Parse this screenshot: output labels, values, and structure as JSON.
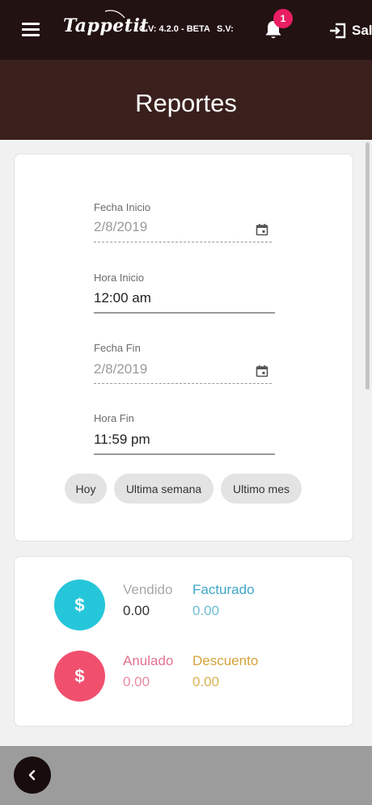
{
  "topbar": {
    "logo_text": "Tappetit",
    "version": "C.V: 4.2.0 - BETA",
    "sv_label": "S.V:",
    "notification_count": "1",
    "exit_label": "Salir"
  },
  "header": {
    "title": "Reportes"
  },
  "form": {
    "fecha_inicio": {
      "label": "Fecha Inicio",
      "value": "2/8/2019"
    },
    "hora_inicio": {
      "label": "Hora Inicio",
      "value": "12:00 am"
    },
    "fecha_fin": {
      "label": "Fecha Fin",
      "value": "2/8/2019"
    },
    "hora_fin": {
      "label": "Hora Fin",
      "value": "11:59 pm"
    },
    "chips": [
      "Hoy",
      "Ultima semana",
      "Ultimo mes"
    ]
  },
  "totals": {
    "currency_symbol": "$",
    "vendido": {
      "label": "Vendido",
      "value": "0.00"
    },
    "facturado": {
      "label": "Facturado",
      "value": "0.00"
    },
    "anulado": {
      "label": "Anulado",
      "value": "0.00"
    },
    "descuento": {
      "label": "Descuento",
      "value": "0.00"
    }
  },
  "colors": {
    "topbar": "#231212",
    "header": "#3a201d",
    "badge": "#e91e63",
    "cyan": "#26c6da",
    "pink": "#f0506e",
    "facturado": "#3fa6c8",
    "anulado": "#e2728d",
    "descuento": "#d4a33a"
  }
}
